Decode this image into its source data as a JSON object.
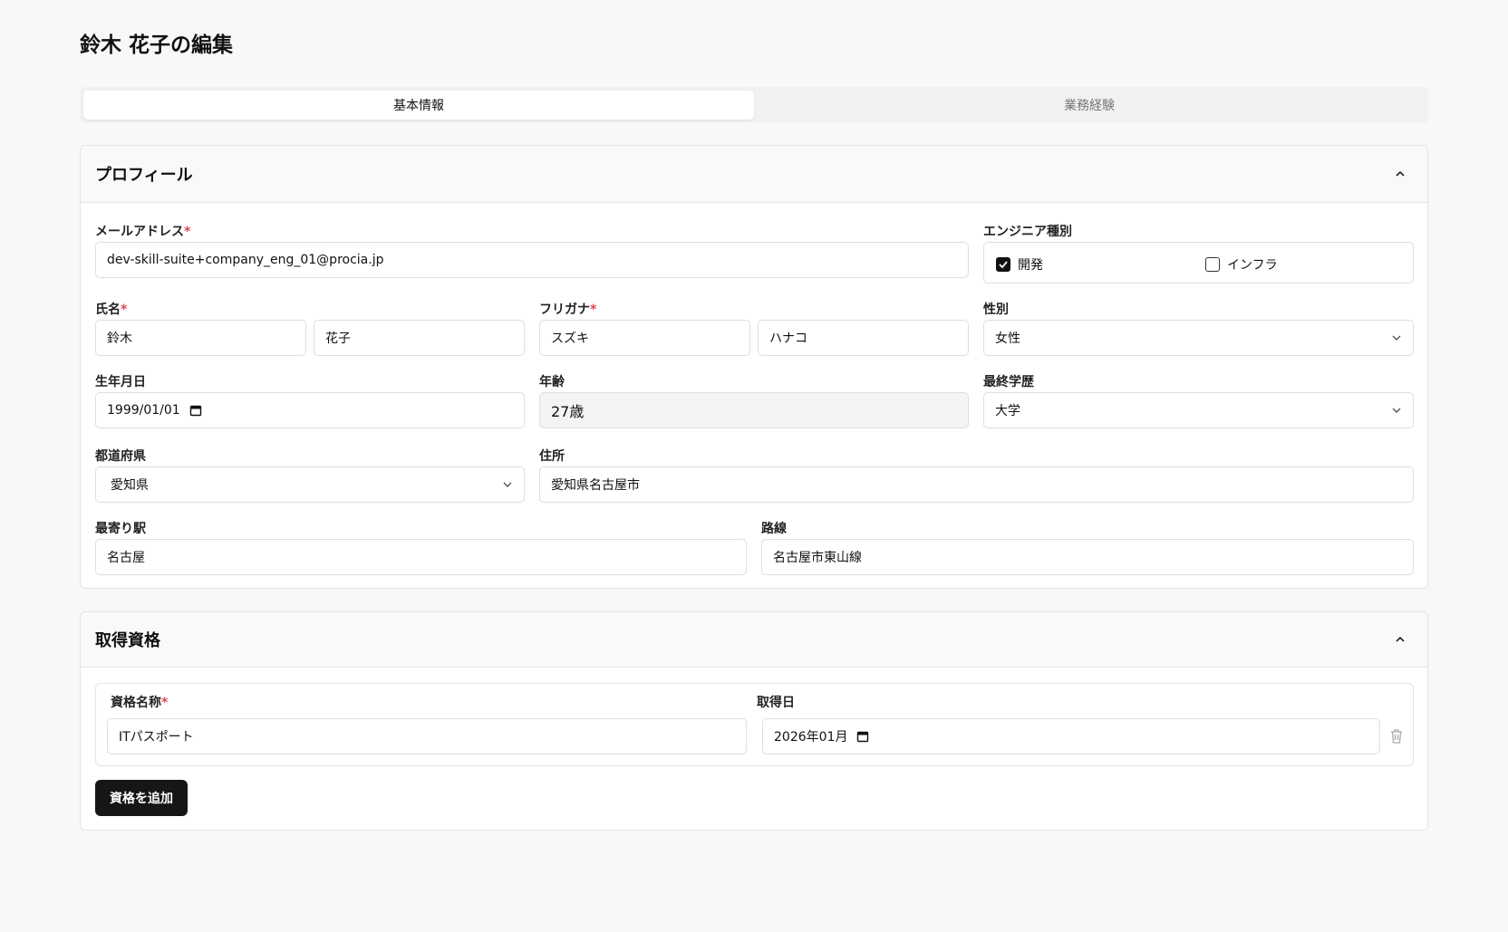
{
  "page": {
    "title": "鈴木 花子の編集"
  },
  "tabs": [
    {
      "label": "基本情報",
      "active": true
    },
    {
      "label": "業務経験",
      "active": false
    }
  ],
  "profile": {
    "title": "プロフィール",
    "email": {
      "label": "メールアドレス",
      "required": "*",
      "value": "dev-skill-suite+company_eng_01@procia.jp"
    },
    "engineer_type": {
      "label": "エンジニア種別",
      "options": [
        {
          "label": "開発",
          "checked": true
        },
        {
          "label": "インフラ",
          "checked": false
        }
      ]
    },
    "name": {
      "label": "氏名",
      "required": "*",
      "last": "鈴木",
      "first": "花子"
    },
    "kana": {
      "label": "フリガナ",
      "required": "*",
      "last": "スズキ",
      "first": "ハナコ"
    },
    "gender": {
      "label": "性別",
      "value": "女性"
    },
    "birthdate": {
      "label": "生年月日",
      "value": "1999/01/01"
    },
    "age": {
      "label": "年齢",
      "value": "27歳"
    },
    "education": {
      "label": "最終学歴",
      "value": "大学"
    },
    "prefecture": {
      "label": "都道府県",
      "value": "愛知県"
    },
    "address": {
      "label": "住所",
      "value": "愛知県名古屋市"
    },
    "station": {
      "label": "最寄り駅",
      "value": "名古屋"
    },
    "line": {
      "label": "路線",
      "value": "名古屋市東山線"
    }
  },
  "qualifications": {
    "title": "取得資格",
    "name_label": "資格名称",
    "required": "*",
    "date_label": "取得日",
    "items": [
      {
        "name": "ITパスポート",
        "date": "2026年01月"
      }
    ],
    "add_label": "資格を追加"
  },
  "icons": {
    "collapse": "chevron-up-icon",
    "select": "chevron-down-icon",
    "date": "calendar-icon",
    "check": "check-icon",
    "delete": "trash-icon"
  },
  "colors": {
    "required": "#e0474c",
    "primary_button": "#161616",
    "active_tab": "#ffffff"
  }
}
